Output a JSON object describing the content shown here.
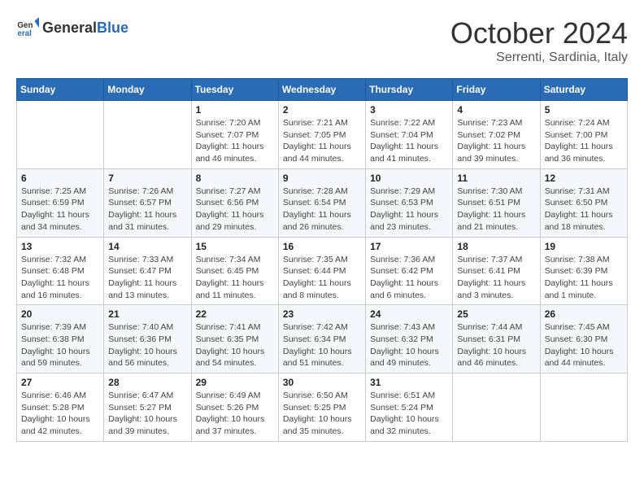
{
  "header": {
    "logo_general": "General",
    "logo_blue": "Blue",
    "month_title": "October 2024",
    "location": "Serrenti, Sardinia, Italy"
  },
  "days_of_week": [
    "Sunday",
    "Monday",
    "Tuesday",
    "Wednesday",
    "Thursday",
    "Friday",
    "Saturday"
  ],
  "weeks": [
    [
      {
        "day": "",
        "info": ""
      },
      {
        "day": "",
        "info": ""
      },
      {
        "day": "1",
        "info": "Sunrise: 7:20 AM\nSunset: 7:07 PM\nDaylight: 11 hours and 46 minutes."
      },
      {
        "day": "2",
        "info": "Sunrise: 7:21 AM\nSunset: 7:05 PM\nDaylight: 11 hours and 44 minutes."
      },
      {
        "day": "3",
        "info": "Sunrise: 7:22 AM\nSunset: 7:04 PM\nDaylight: 11 hours and 41 minutes."
      },
      {
        "day": "4",
        "info": "Sunrise: 7:23 AM\nSunset: 7:02 PM\nDaylight: 11 hours and 39 minutes."
      },
      {
        "day": "5",
        "info": "Sunrise: 7:24 AM\nSunset: 7:00 PM\nDaylight: 11 hours and 36 minutes."
      }
    ],
    [
      {
        "day": "6",
        "info": "Sunrise: 7:25 AM\nSunset: 6:59 PM\nDaylight: 11 hours and 34 minutes."
      },
      {
        "day": "7",
        "info": "Sunrise: 7:26 AM\nSunset: 6:57 PM\nDaylight: 11 hours and 31 minutes."
      },
      {
        "day": "8",
        "info": "Sunrise: 7:27 AM\nSunset: 6:56 PM\nDaylight: 11 hours and 29 minutes."
      },
      {
        "day": "9",
        "info": "Sunrise: 7:28 AM\nSunset: 6:54 PM\nDaylight: 11 hours and 26 minutes."
      },
      {
        "day": "10",
        "info": "Sunrise: 7:29 AM\nSunset: 6:53 PM\nDaylight: 11 hours and 23 minutes."
      },
      {
        "day": "11",
        "info": "Sunrise: 7:30 AM\nSunset: 6:51 PM\nDaylight: 11 hours and 21 minutes."
      },
      {
        "day": "12",
        "info": "Sunrise: 7:31 AM\nSunset: 6:50 PM\nDaylight: 11 hours and 18 minutes."
      }
    ],
    [
      {
        "day": "13",
        "info": "Sunrise: 7:32 AM\nSunset: 6:48 PM\nDaylight: 11 hours and 16 minutes."
      },
      {
        "day": "14",
        "info": "Sunrise: 7:33 AM\nSunset: 6:47 PM\nDaylight: 11 hours and 13 minutes."
      },
      {
        "day": "15",
        "info": "Sunrise: 7:34 AM\nSunset: 6:45 PM\nDaylight: 11 hours and 11 minutes."
      },
      {
        "day": "16",
        "info": "Sunrise: 7:35 AM\nSunset: 6:44 PM\nDaylight: 11 hours and 8 minutes."
      },
      {
        "day": "17",
        "info": "Sunrise: 7:36 AM\nSunset: 6:42 PM\nDaylight: 11 hours and 6 minutes."
      },
      {
        "day": "18",
        "info": "Sunrise: 7:37 AM\nSunset: 6:41 PM\nDaylight: 11 hours and 3 minutes."
      },
      {
        "day": "19",
        "info": "Sunrise: 7:38 AM\nSunset: 6:39 PM\nDaylight: 11 hours and 1 minute."
      }
    ],
    [
      {
        "day": "20",
        "info": "Sunrise: 7:39 AM\nSunset: 6:38 PM\nDaylight: 10 hours and 59 minutes."
      },
      {
        "day": "21",
        "info": "Sunrise: 7:40 AM\nSunset: 6:36 PM\nDaylight: 10 hours and 56 minutes."
      },
      {
        "day": "22",
        "info": "Sunrise: 7:41 AM\nSunset: 6:35 PM\nDaylight: 10 hours and 54 minutes."
      },
      {
        "day": "23",
        "info": "Sunrise: 7:42 AM\nSunset: 6:34 PM\nDaylight: 10 hours and 51 minutes."
      },
      {
        "day": "24",
        "info": "Sunrise: 7:43 AM\nSunset: 6:32 PM\nDaylight: 10 hours and 49 minutes."
      },
      {
        "day": "25",
        "info": "Sunrise: 7:44 AM\nSunset: 6:31 PM\nDaylight: 10 hours and 46 minutes."
      },
      {
        "day": "26",
        "info": "Sunrise: 7:45 AM\nSunset: 6:30 PM\nDaylight: 10 hours and 44 minutes."
      }
    ],
    [
      {
        "day": "27",
        "info": "Sunrise: 6:46 AM\nSunset: 5:28 PM\nDaylight: 10 hours and 42 minutes."
      },
      {
        "day": "28",
        "info": "Sunrise: 6:47 AM\nSunset: 5:27 PM\nDaylight: 10 hours and 39 minutes."
      },
      {
        "day": "29",
        "info": "Sunrise: 6:49 AM\nSunset: 5:26 PM\nDaylight: 10 hours and 37 minutes."
      },
      {
        "day": "30",
        "info": "Sunrise: 6:50 AM\nSunset: 5:25 PM\nDaylight: 10 hours and 35 minutes."
      },
      {
        "day": "31",
        "info": "Sunrise: 6:51 AM\nSunset: 5:24 PM\nDaylight: 10 hours and 32 minutes."
      },
      {
        "day": "",
        "info": ""
      },
      {
        "day": "",
        "info": ""
      }
    ]
  ]
}
